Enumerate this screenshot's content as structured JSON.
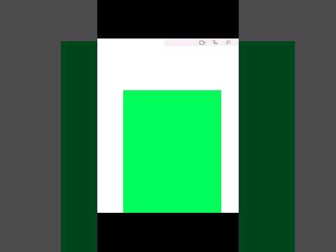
{
  "colors": {
    "background": "#4a4a4a",
    "side_panels": "#00461b",
    "letterbox": "#000000",
    "window": "#ffffff",
    "toolbar": "#f6eff6",
    "media": "#00ff5a",
    "icon": "#9a9a9a"
  },
  "toolbar": {
    "icons": [
      "video-call-icon",
      "phone-icon",
      "search-icon"
    ]
  },
  "media": {
    "description": ""
  }
}
